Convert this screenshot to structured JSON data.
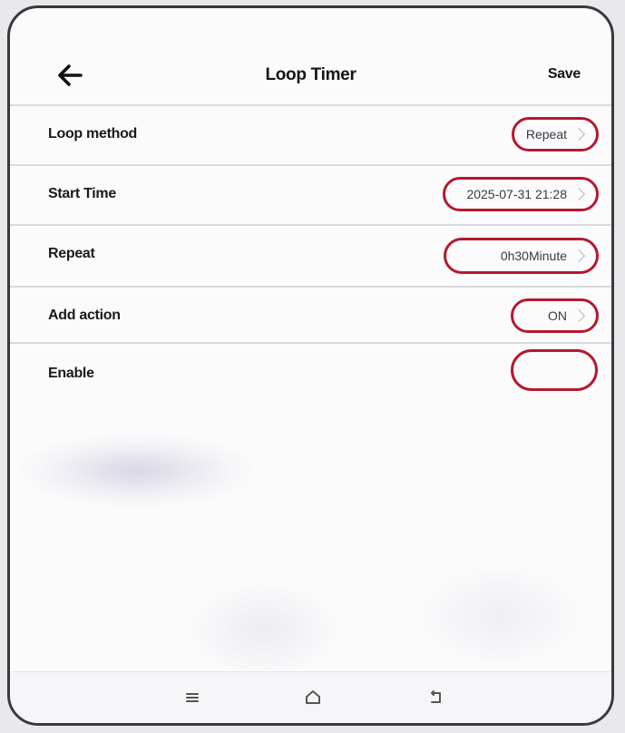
{
  "header": {
    "back_icon": "arrow-left-icon",
    "title": "Loop Timer",
    "save_label": "Save"
  },
  "rows": [
    {
      "label": "Loop method",
      "value": "Repeat",
      "has_chevron": true
    },
    {
      "label": "Start Time",
      "value": "2025-07-31 21:28",
      "has_chevron": true
    },
    {
      "label": "Repeat",
      "value": "0h30Minute",
      "has_chevron": true
    },
    {
      "label": "Add action",
      "value": "ON",
      "has_chevron": true
    },
    {
      "label": "Enable",
      "value": "",
      "has_chevron": false
    }
  ],
  "navbar": {
    "icons": [
      "menu-icon",
      "home-icon",
      "return-icon"
    ]
  },
  "colors": {
    "highlight_border": "#b5182f",
    "text": "#1a1a1a",
    "background": "#fbfbfc"
  }
}
